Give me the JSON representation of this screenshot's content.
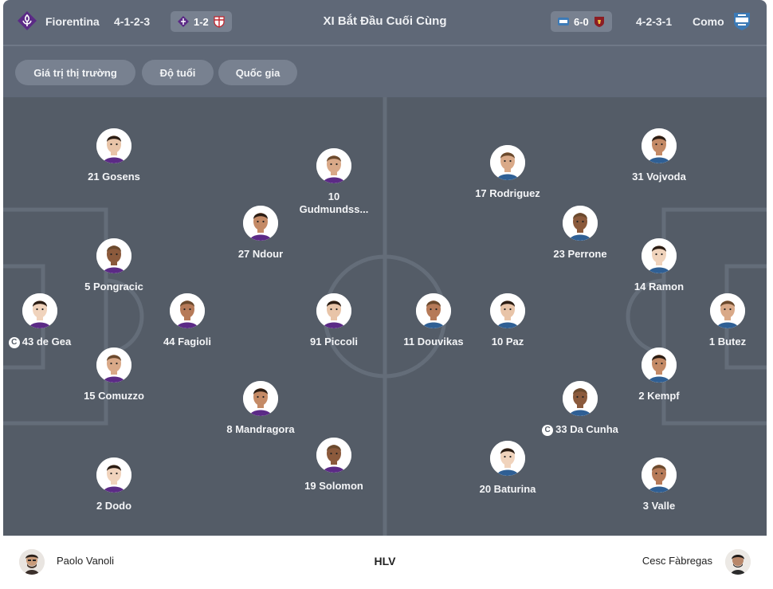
{
  "header": {
    "home_team": "Fiorentina",
    "home_formation": "4-1-2-3",
    "home_last_score": "1-2",
    "title": "XI Bắt Đầu Cuối Cùng",
    "away_last_score": "6-0",
    "away_formation": "4-2-3-1",
    "away_team": "Como"
  },
  "filters": [
    "Giá trị thị trường",
    "Độ tuổi",
    "Quốc gia"
  ],
  "home_players": [
    {
      "label": "21 Gosens"
    },
    {
      "label": "10 Gudmundss..."
    },
    {
      "label": "27 Ndour"
    },
    {
      "label": "5 Pongracic"
    },
    {
      "label": "43 de Gea",
      "captain": true
    },
    {
      "label": "44 Fagioli"
    },
    {
      "label": "91 Piccoli"
    },
    {
      "label": "15 Comuzzo"
    },
    {
      "label": "8 Mandragora"
    },
    {
      "label": "19 Solomon"
    },
    {
      "label": "2 Dodo"
    }
  ],
  "away_players": [
    {
      "label": "17 Rodriguez"
    },
    {
      "label": "31 Vojvoda"
    },
    {
      "label": "23 Perrone"
    },
    {
      "label": "14 Ramon"
    },
    {
      "label": "11 Douvikas"
    },
    {
      "label": "10 Paz"
    },
    {
      "label": "1 Butez"
    },
    {
      "label": "2 Kempf"
    },
    {
      "label": "33 Da Cunha",
      "captain": true
    },
    {
      "label": "20 Baturina"
    },
    {
      "label": "3 Valle"
    }
  ],
  "captain_mark": "C",
  "coaches": {
    "home": "Paolo Vanoli",
    "label": "HLV",
    "away": "Cesc Fàbregas"
  },
  "colors": {
    "header_bg": "#5f6877",
    "pitch_bg": "#545c67",
    "chip_bg": "#788190",
    "fiorentina_purple": "#5b2a86",
    "como_blue": "#3c7ab6"
  }
}
